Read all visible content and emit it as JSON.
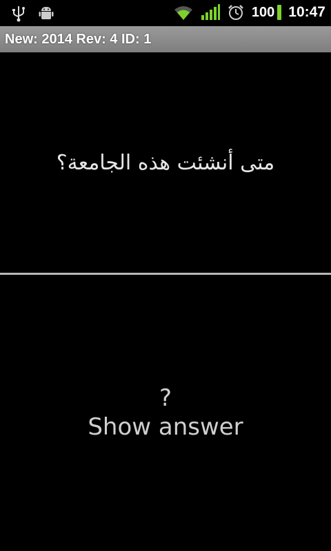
{
  "status_bar": {
    "icons_left": [
      "usb-icon",
      "android-debug-icon"
    ],
    "icons_right": [
      "wifi-icon",
      "signal-icon",
      "alarm-icon"
    ],
    "battery": "100",
    "time": "10:47",
    "battery_color": "#7cd22b",
    "signal_color": "#7cd22b"
  },
  "title_bar": {
    "text": "New: 2014 Rev: 4 ID: 1"
  },
  "card": {
    "question": "متى أنشئت هذه الجامعة؟",
    "answer_placeholder": "?",
    "show_answer_label": "Show answer"
  }
}
